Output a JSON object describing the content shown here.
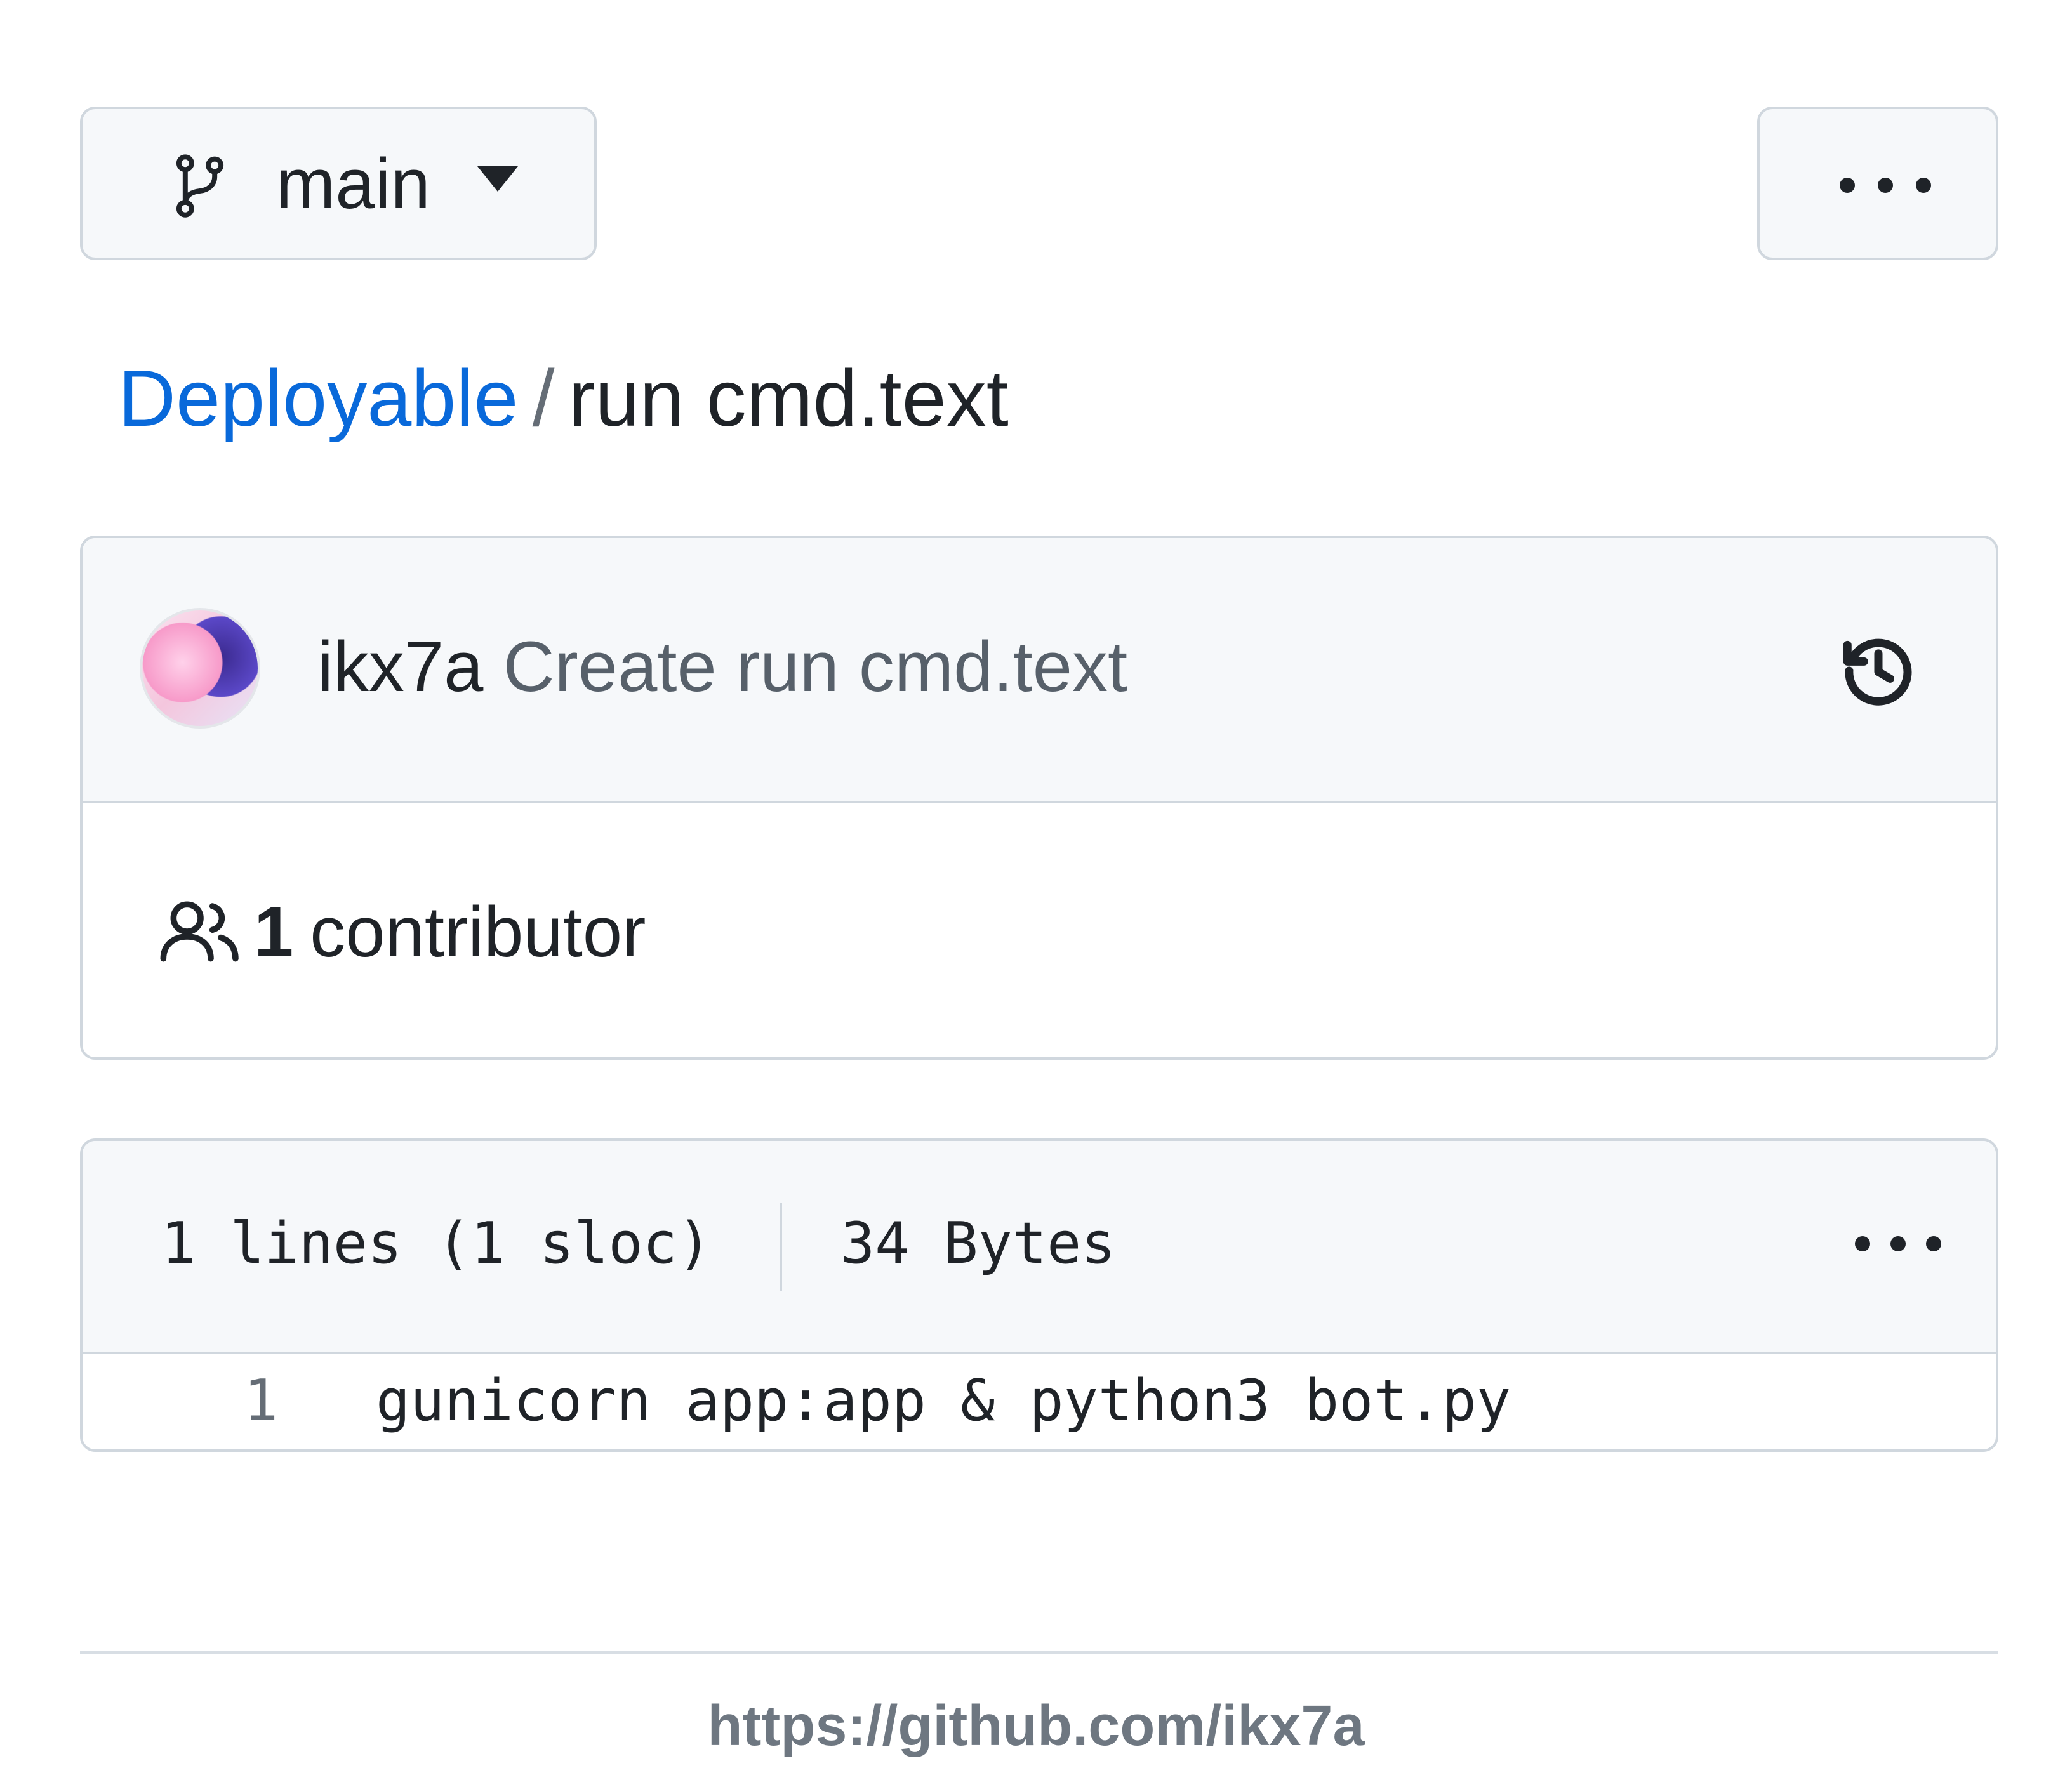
{
  "branch_selector": {
    "branch_name": "main",
    "icon": "git-branch-icon",
    "caret": "triangle-down-icon"
  },
  "top_more_button": {
    "icon": "kebab-horizontal-icon"
  },
  "breadcrumb": {
    "repo": "Deployable",
    "separator": "/",
    "file": "run cmd.text"
  },
  "latest_commit": {
    "author": "ikx7a",
    "message": "Create run cmd.text",
    "history_icon": "history-icon"
  },
  "contributors": {
    "icon": "people-icon",
    "count": "1",
    "label": "contributor"
  },
  "file_info": {
    "lines": "1 lines (1 sloc)",
    "size": "34 Bytes",
    "more_icon": "kebab-horizontal-icon"
  },
  "code": {
    "lines": [
      {
        "number": "1",
        "text": "gunicorn app:app & python3 bot.py"
      }
    ]
  },
  "footer": {
    "url": "https://github.com/ikx7a"
  },
  "colors": {
    "link": "#0969da",
    "border": "#d0d7de",
    "header_bg": "#f6f8fa",
    "muted": "#57606a"
  }
}
